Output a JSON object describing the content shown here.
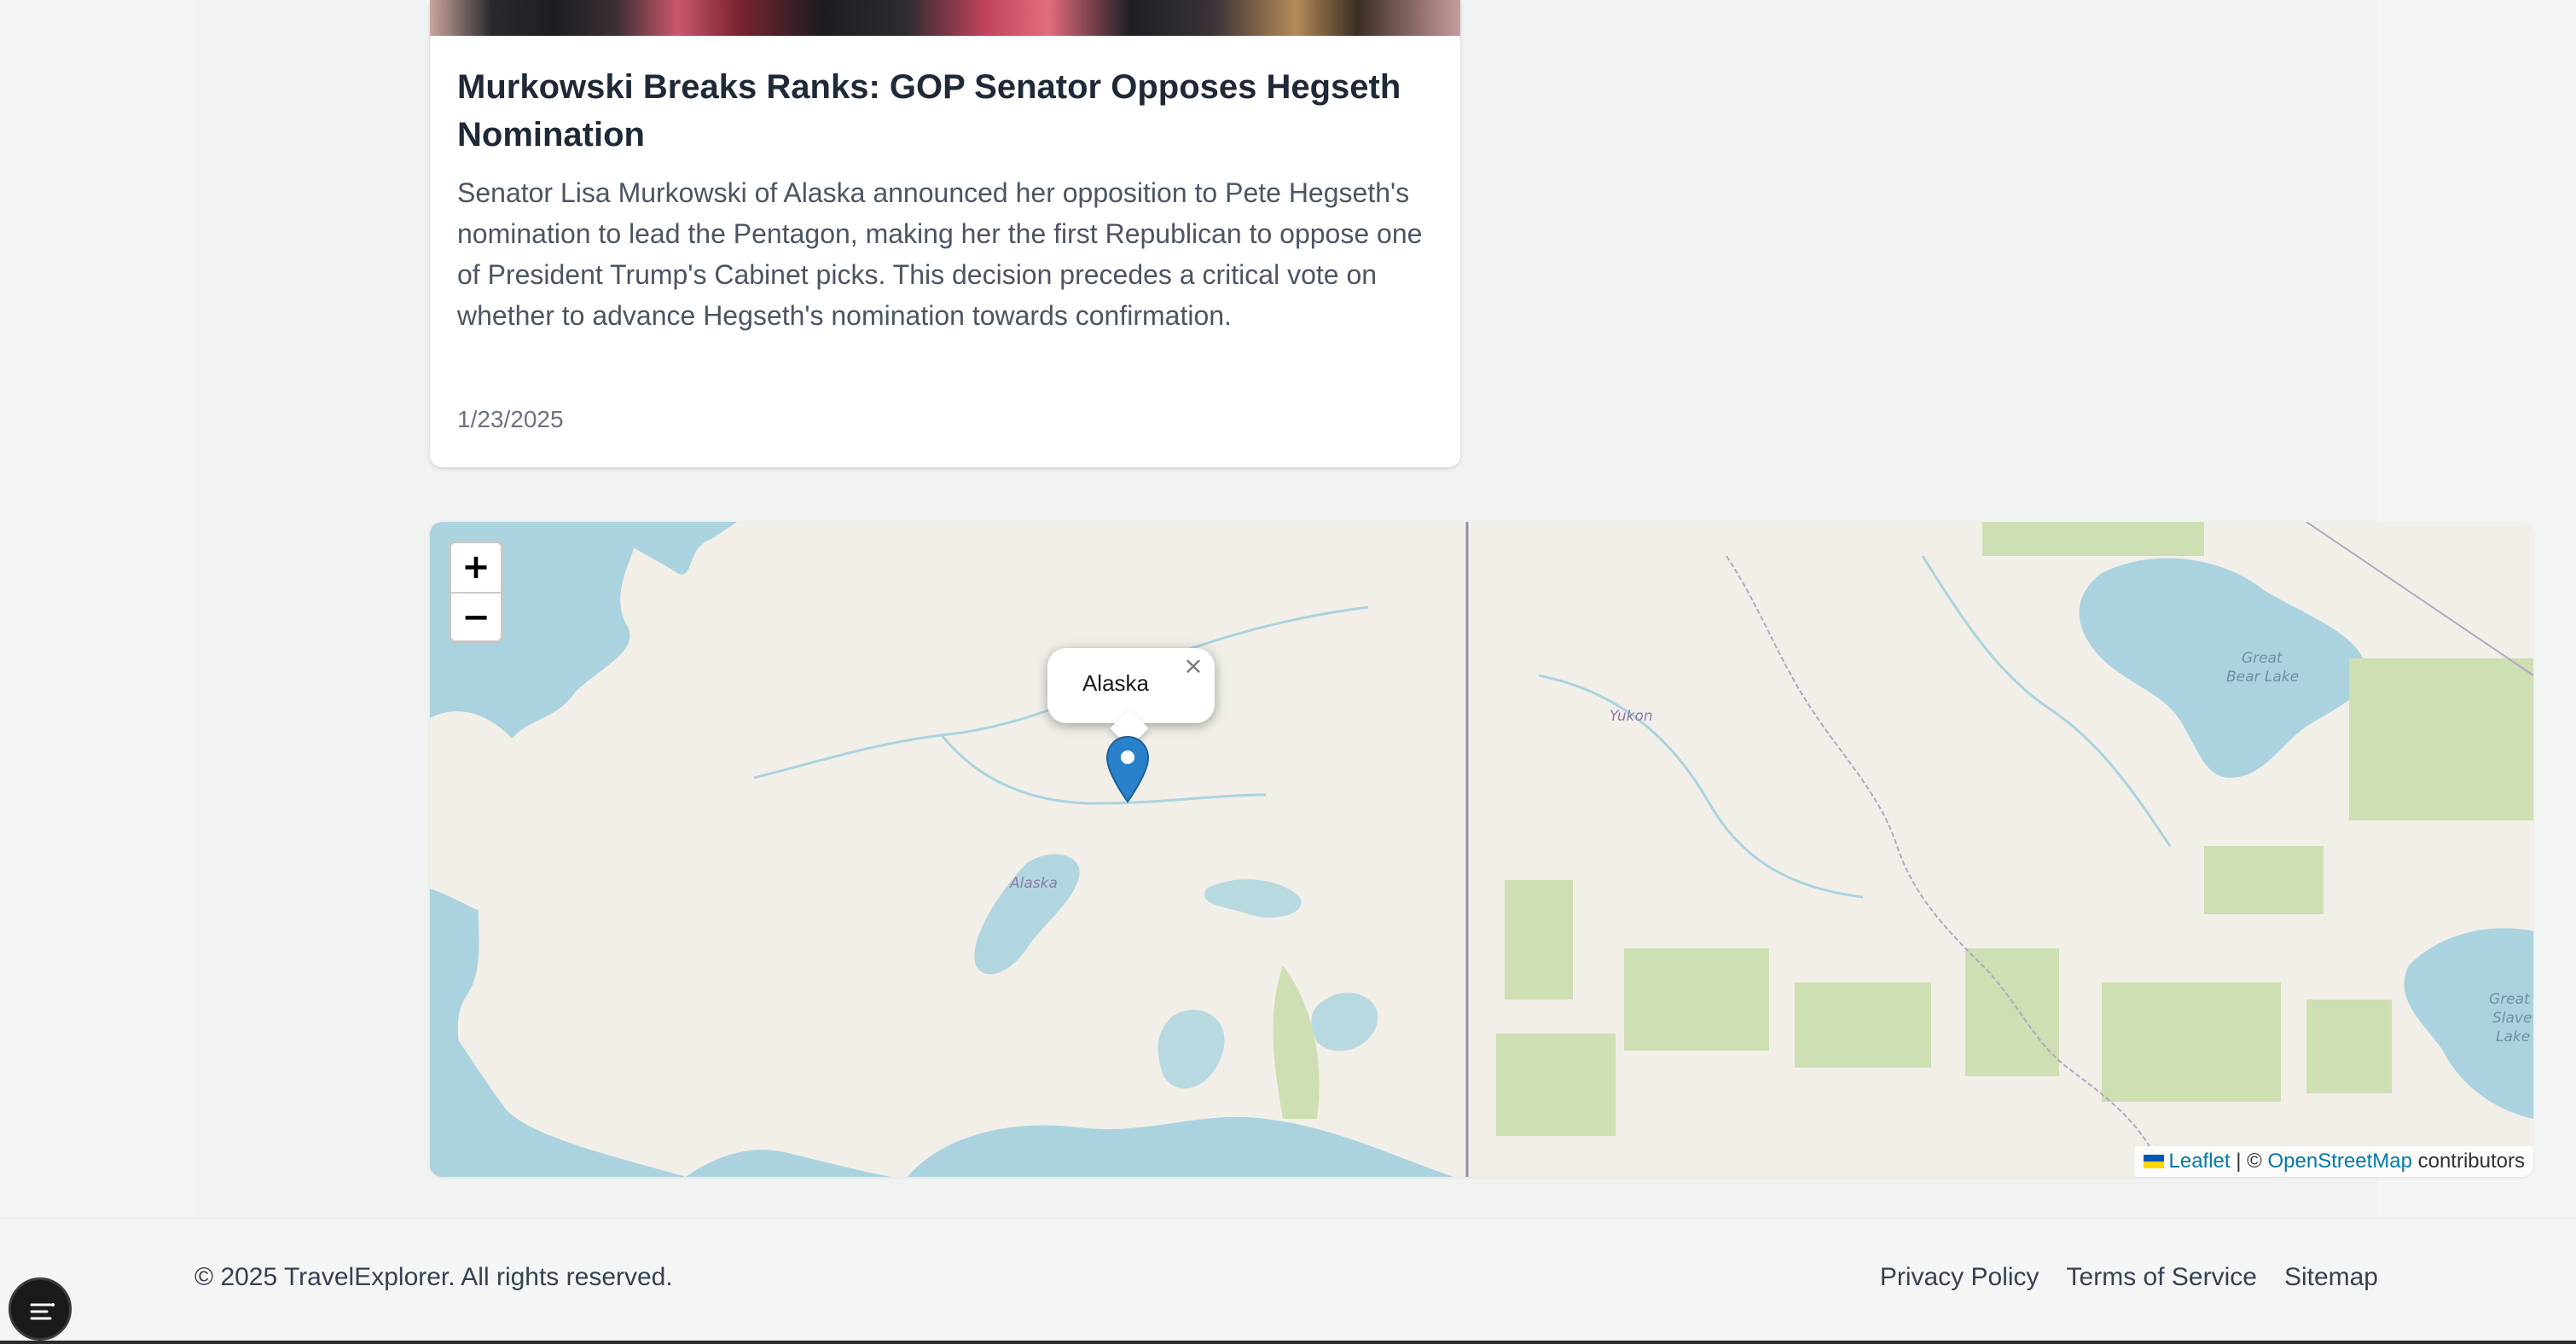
{
  "article": {
    "title": "Murkowski Breaks Ranks: GOP Senator Opposes Hegseth Nomination",
    "summary": "Senator Lisa Murkowski of Alaska announced her opposition to Pete Hegseth's nomination to lead the Pentagon, making her the first Republican to oppose one of President Trump's Cabinet picks. This decision precedes a critical vote on whether to advance Hegseth's nomination towards confirmation.",
    "date": "1/23/2025"
  },
  "map": {
    "zoom_in": "+",
    "zoom_out": "−",
    "popup_text": "Alaska",
    "popup_close": "×",
    "labels": {
      "alaska": "Alaska",
      "yukon": "Yukon",
      "great_bear_1": "Great",
      "great_bear_2": "Bear Lake",
      "great_slave_1": "Great",
      "great_slave_2": "Slave",
      "great_slave_3": "Lake"
    },
    "attribution": {
      "leaflet": "Leaflet",
      "separator": " | © ",
      "osm": "OpenStreetMap",
      "suffix": " contributors"
    },
    "colors": {
      "land": "#f2efe9",
      "water": "#aad3df",
      "forest": "#cddfb3",
      "marker": "#2a81cb"
    }
  },
  "footer": {
    "copyright": "© 2025 TravelExplorer. All rights reserved.",
    "links": [
      "Privacy Policy",
      "Terms of Service",
      "Sitemap"
    ]
  },
  "fab": {
    "icon": "menu-lines-icon"
  }
}
